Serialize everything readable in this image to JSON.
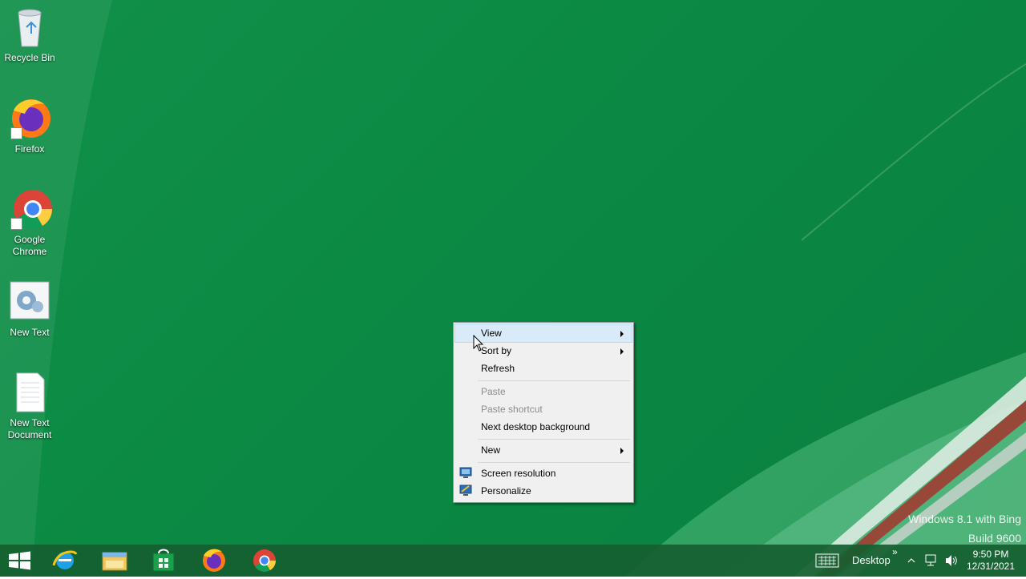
{
  "desktop": {
    "icons": [
      {
        "label": "Recycle Bin",
        "icon": "recycle-bin-icon"
      },
      {
        "label": "Firefox",
        "icon": "firefox-icon"
      },
      {
        "label": "Google Chrome",
        "icon": "chrome-icon"
      },
      {
        "label": "New Text",
        "icon": "settings-gear-icon"
      },
      {
        "label": "New Text Document",
        "icon": "text-document-icon"
      }
    ]
  },
  "context_menu": {
    "items": [
      {
        "label": "View",
        "enabled": true,
        "submenu": true
      },
      {
        "label": "Sort by",
        "enabled": true,
        "submenu": true
      },
      {
        "label": "Refresh",
        "enabled": true,
        "submenu": false
      },
      {
        "label": "Paste",
        "enabled": false,
        "submenu": false
      },
      {
        "label": "Paste shortcut",
        "enabled": false,
        "submenu": false
      },
      {
        "label": "Next desktop background",
        "enabled": true,
        "submenu": false
      },
      {
        "label": "New",
        "enabled": true,
        "submenu": true
      },
      {
        "label": "Screen resolution",
        "enabled": true,
        "icon": "monitor-icon"
      },
      {
        "label": "Personalize",
        "enabled": true,
        "icon": "personalize-icon"
      }
    ]
  },
  "watermark": {
    "line1": "Windows 8.1 with Bing",
    "line2": "Build 9600"
  },
  "taskbar": {
    "pinned": [
      "start-icon",
      "internet-explorer-icon",
      "file-explorer-icon",
      "store-icon",
      "firefox-icon",
      "chrome-icon"
    ],
    "toolbar_label": "Desktop",
    "chevron": "»",
    "time": "9:50 PM",
    "date": "12/31/2021"
  },
  "colors": {
    "wallpaper": "#0b8a44",
    "taskbar": "#165e30",
    "menu_bg": "#f0f0f0",
    "menu_highlight": "#d9ebf9"
  }
}
